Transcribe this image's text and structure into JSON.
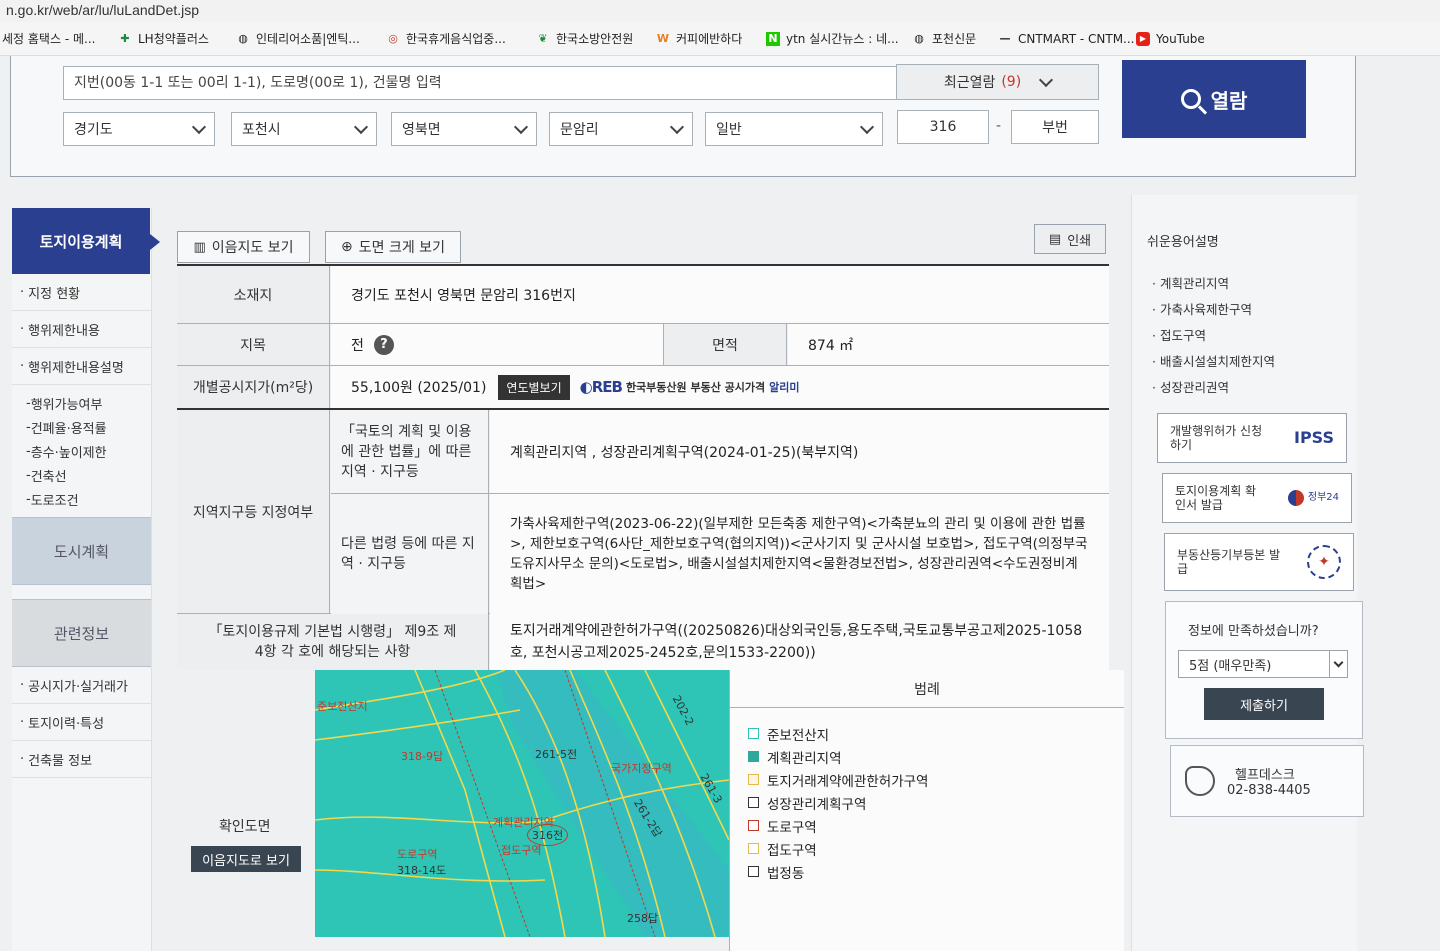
{
  "browser": {
    "url": "n.go.kr/web/ar/lu/luLandDet.jsp",
    "bookmarks": [
      {
        "label": "세정 홈택스 - 메...",
        "icon": "document-icon"
      },
      {
        "label": "LH청약플러스",
        "icon": "plus-icon"
      },
      {
        "label": "인테리어소품|엔틱...",
        "icon": "globe-icon"
      },
      {
        "label": "한국휴게음식업중...",
        "icon": "circle-icon"
      },
      {
        "label": "한국소방안전원",
        "icon": "leaf-icon"
      },
      {
        "label": "커피에반하다",
        "icon": "coffee-icon"
      },
      {
        "label": "ytn 실시간뉴스 : 네...",
        "icon": "naver-icon"
      },
      {
        "label": "포천신문",
        "icon": "globe-icon"
      },
      {
        "label": "CNTMART - CNTM...",
        "icon": "dash-icon"
      },
      {
        "label": "YouTube",
        "icon": "youtube-icon"
      }
    ]
  },
  "search": {
    "address_placeholder": "지번(00동 1-1 또는 00리 1-1), 도로명(00로 1), 건물명 입력",
    "recent_label": "최근열람",
    "recent_count": "(9)",
    "province": "경기도",
    "city": "포천시",
    "district": "영북면",
    "village": "문암리",
    "land_type": "일반",
    "main_number": "316",
    "sub_number_placeholder": "부번",
    "dash": "-",
    "view_button": "열람"
  },
  "leftnav": {
    "head": "토지이용계획",
    "items": [
      "지정 현황",
      "행위제한내용",
      "행위제한내용설명"
    ],
    "subitems": [
      "행위가능여부",
      "건폐율·용적률",
      "층수·높이제한",
      "건축선",
      "도로조건"
    ],
    "block_city": "도시계획",
    "block_related": "관련정보",
    "related_items": [
      "공시지가·실거래가",
      "토지이력·특성",
      "건축물 정보"
    ]
  },
  "toolbar": {
    "map_view": "이음지도 보기",
    "enlarge": "도면 크게 보기",
    "print": "인쇄"
  },
  "info": {
    "location_label": "소재지",
    "location_value": "경기도 포천시 영북면 문암리 316번지",
    "category_label": "지목",
    "category_value": "전",
    "category_help": "?",
    "area_label": "면적",
    "area_value": "874 ㎡",
    "price_label": "개별공시지가(m²당)",
    "price_value": "55,100원 (2025/01)",
    "year_button": "연도별보기",
    "reb_logo": "REB",
    "reb_text": "한국부동산원 부동산 공시가격",
    "reb_alert": "알리미",
    "zone_label": "지역지구등 지정여부",
    "zone_law_label": "「국토의 계획 및 이용에 관한 법률」에 따른 지역 · 지구등",
    "zone_law_value": "계획관리지역 , 성장관리계획구역(2024-01-25)(북부지역)",
    "zone_other_label": "다른 법령 등에 따른 지역 · 지구등",
    "zone_other_value": "가축사육제한구역(2023-06-22)(일부제한 모든축종 제한구역)<가축분뇨의 관리 및 이용에 관한 법률>, 제한보호구역(6사단_제한보호구역(협의지역))<군사기지 및 군사시설 보호법>, 접도구역(의정부국도유지사무소 문의)<도로법>, 배출시설설치제한지역<물환경보전법>, 성장관리권역<수도권정비계획법>",
    "enforcement_label": "「토지이용규제 기본법 시행령」 제9조 제4항 각 호에 해당되는 사항",
    "enforcement_value": "토지거래계약에관한허가구역((20250826)대상외국인등,용도주택,국토교통부공고제2025-1058호, 포천시공고제2025-2452호,문의1533-2200))"
  },
  "map": {
    "label": "확인도면",
    "button": "이음지도로 보기",
    "texts": {
      "top_label": "준보전산지",
      "plan_zone": "계획관리지역",
      "road_zone": "도로구역",
      "parcel_316": "316전",
      "parcel_261_5": "261-5전",
      "parcel_318_9": "318-9답",
      "parcel_318_14": "318-14도",
      "parcel_258": "258답",
      "parcel_261_2": "261-2답",
      "parcel_261_3": "261-3",
      "parcel_202": "202-2",
      "setback": "접도구역",
      "national_zone": "국가지정구역"
    },
    "colors": {
      "land": "#2ec5b6",
      "boundary": "#f2d84a",
      "label": "#c0392b"
    }
  },
  "legend": {
    "title": "범례",
    "items": [
      {
        "label": "준보전산지",
        "color": "#ffffff",
        "border": "#2ec5b6"
      },
      {
        "label": "계획관리지역",
        "color": "#2ea89a",
        "border": "#2ea89a"
      },
      {
        "label": "토지거래계약에관한허가구역",
        "color": "#fdf6e0",
        "border": "#e6b94f"
      },
      {
        "label": "성장관리계획구역",
        "color": "#ffffff",
        "border": "#333333"
      },
      {
        "label": "도로구역",
        "color": "#ffffff",
        "border": "#c0392b"
      },
      {
        "label": "접도구역",
        "color": "#ffffff",
        "border": "#e6b94f"
      },
      {
        "label": "법정동",
        "color": "#ffffff",
        "border": "#333333"
      }
    ]
  },
  "rightbar": {
    "glossary_title": "쉬운용어설명",
    "glossary": [
      "계획관리지역",
      "가축사육제한구역",
      "접도구역",
      "배출시설설치제한지역",
      "성장관리권역"
    ],
    "services": [
      {
        "label": "개발행위허가 신청하기",
        "logo": "IPSS"
      },
      {
        "label": "토지이용계획 확인서 발급",
        "logo": "정부24"
      },
      {
        "label": "부동산등기부등본 발급",
        "logo": ""
      }
    ],
    "survey_question": "정보에 만족하셨습니까?",
    "survey_selected": "5점 (매우만족)",
    "survey_submit": "제출하기",
    "help_label": "헬프데스크",
    "help_phone": "02-838-4405"
  }
}
